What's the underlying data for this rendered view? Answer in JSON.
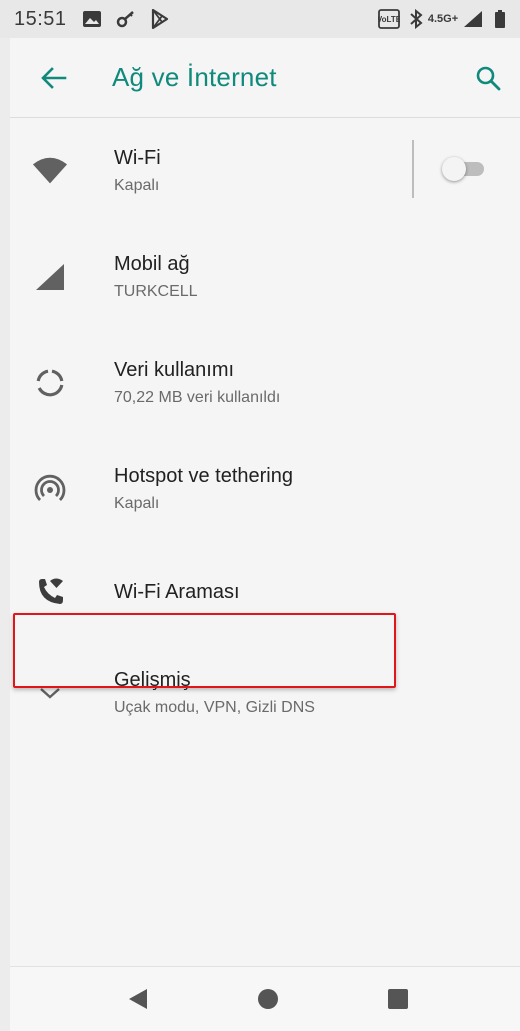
{
  "status_bar": {
    "time": "15:51",
    "left_icons": [
      "image-icon",
      "key-icon",
      "play-store-icon"
    ],
    "right_icons": [
      "volte-icon",
      "bluetooth-icon",
      "4g-plus-icon",
      "signal-icon",
      "battery-icon"
    ],
    "network_label": "4.5G+"
  },
  "app_bar": {
    "title": "Ağ ve İnternet",
    "accent_color": "#108a7c"
  },
  "items": [
    {
      "name": "wifi",
      "title": "Wi-Fi",
      "subtitle": "Kapalı",
      "icon": "wifi-icon",
      "toggle_on": false
    },
    {
      "name": "mobile-network",
      "title": "Mobil ağ",
      "subtitle": "TURKCELL",
      "icon": "cell-signal-icon"
    },
    {
      "name": "data-usage",
      "title": "Veri kullanımı",
      "subtitle": "70,22 MB veri kullanıldı",
      "icon": "data-usage-icon"
    },
    {
      "name": "hotspot",
      "title": "Hotspot ve tethering",
      "subtitle": "Kapalı",
      "icon": "hotspot-icon"
    },
    {
      "name": "wifi-calling",
      "title": "Wi-Fi Araması",
      "icon": "wifi-calling-icon",
      "highlighted": true,
      "highlight_color": "#e0161b"
    },
    {
      "name": "advanced",
      "title": "Gelişmiş",
      "subtitle": "Uçak modu, VPN, Gizli DNS",
      "icon": "chevron-down-icon"
    }
  ],
  "nav_bar": {
    "buttons": [
      "back-triangle-icon",
      "home-circle-icon",
      "recents-square-icon"
    ]
  }
}
